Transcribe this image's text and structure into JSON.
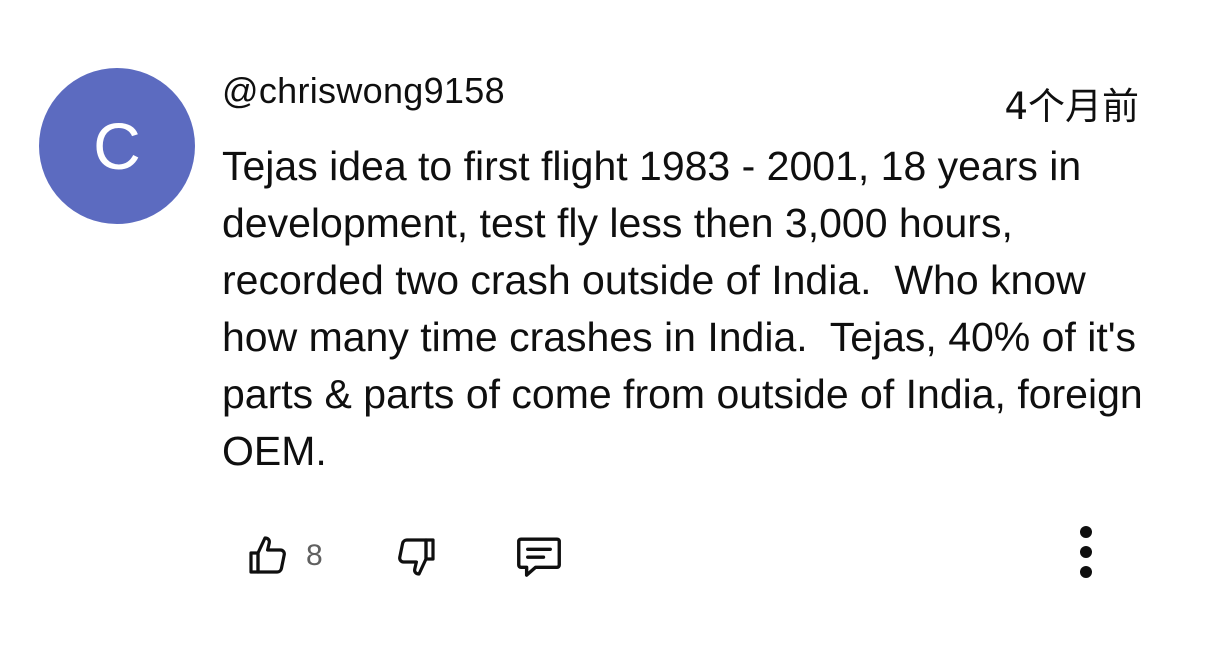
{
  "comment": {
    "avatar_letter": "C",
    "avatar_color": "#5c6bc0",
    "author": "@chriswong9158",
    "timestamp": "4个月前",
    "text": "Tejas idea to first flight 1983 - 2001, 18 years in development, test fly less then 3,000 hours, recorded two crash outside of India.  Who know how many time crashes in India.  Tejas, 40% of it's parts & parts of come from outside of India, foreign OEM.",
    "like_count": "8"
  },
  "actions": {
    "like_icon": "thumbs-up-icon",
    "dislike_icon": "thumbs-down-icon",
    "reply_icon": "comment-reply-icon",
    "more_icon": "vertical-ellipsis-icon"
  }
}
